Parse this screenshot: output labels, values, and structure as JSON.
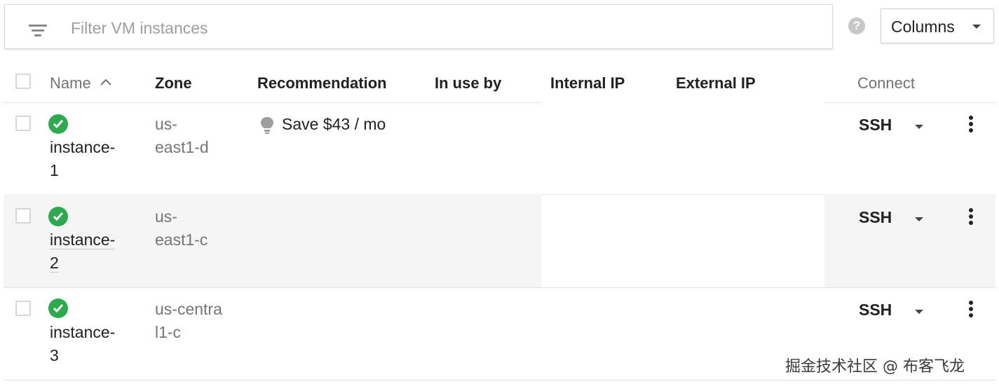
{
  "filter": {
    "placeholder": "Filter VM instances"
  },
  "toolbar": {
    "help_icon": "help-circle-icon",
    "columns_label": "Columns"
  },
  "table": {
    "headers": {
      "name": "Name",
      "zone": "Zone",
      "recommendation": "Recommendation",
      "in_use_by": "In use by",
      "internal_ip": "Internal IP",
      "external_ip": "External IP",
      "connect": "Connect"
    },
    "rows": [
      {
        "name": "instance-1",
        "zone": "us-east1-d",
        "recommendation": "Save $43 / mo",
        "connect": "SSH",
        "status": "running"
      },
      {
        "name": "instance-2",
        "zone": "us-east1-c",
        "recommendation": "",
        "connect": "SSH",
        "status": "running"
      },
      {
        "name": "instance-3",
        "zone": "us-central1-c",
        "recommendation": "",
        "connect": "SSH",
        "status": "running"
      }
    ]
  },
  "colors": {
    "status_ok": "#2eaa4e",
    "row_hover": "#f5f5f5",
    "muted_text": "#757575"
  },
  "watermark": "掘金技术社区 @ 布客飞龙"
}
